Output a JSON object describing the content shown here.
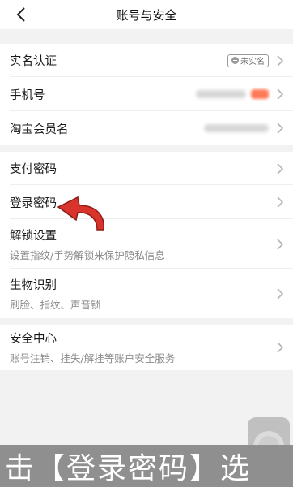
{
  "nav": {
    "title": "账号与安全"
  },
  "group1": {
    "realname": {
      "label": "实名认证",
      "badge": "未实名"
    },
    "phone": {
      "label": "手机号"
    },
    "taobao": {
      "label": "淘宝会员名"
    }
  },
  "group2": {
    "paypw": {
      "label": "支付密码"
    },
    "loginpw": {
      "label": "登录密码"
    },
    "unlock": {
      "label": "解锁设置",
      "sub": "设置指纹/手势解锁来保护隐私信息"
    },
    "bio": {
      "label": "生物识别",
      "sub": "刷脸、指纹、声音锁"
    }
  },
  "group3": {
    "safety": {
      "label": "安全中心",
      "sub": "账号注销、挂失/解挂等账户安全服务"
    }
  },
  "caption": {
    "text": "击【登录密码】选"
  },
  "colors": {
    "accent_arrow": "#d9342b",
    "badge": "#9a9a9a"
  }
}
